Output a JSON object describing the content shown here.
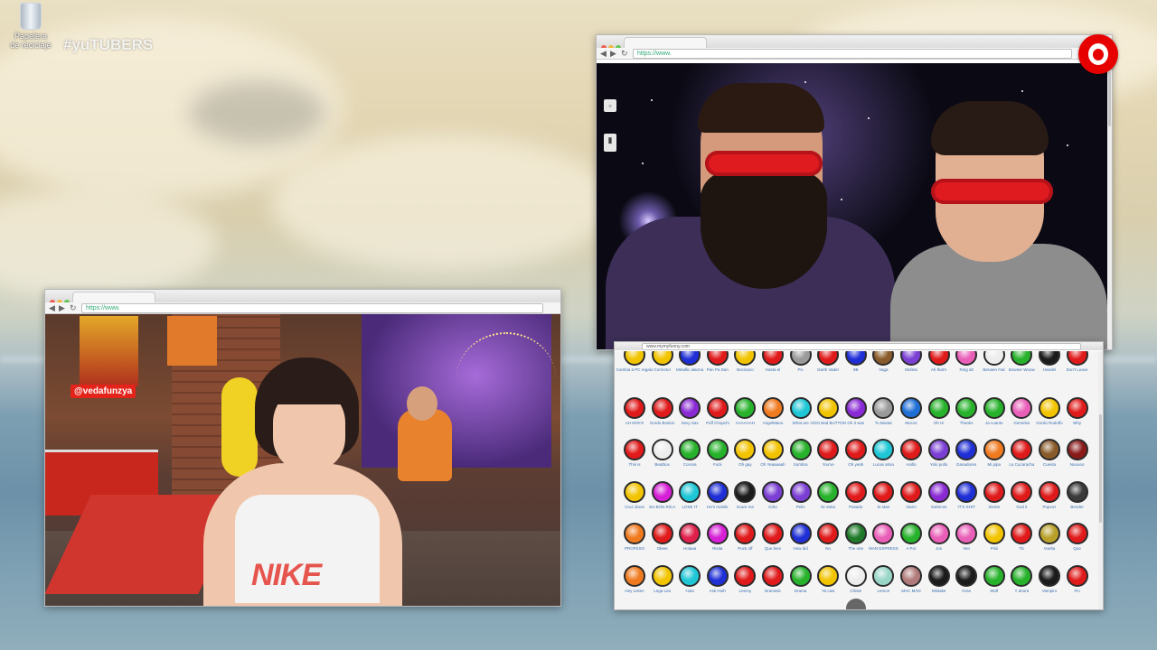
{
  "desktop": {
    "trash_label": "Papelera de reciclaje",
    "brand": "#yuTUBERS"
  },
  "windows": {
    "left": {
      "url": "https://www.",
      "hashtag": "@vedafunzya",
      "shirt_text": "NIKE"
    },
    "right_video": {
      "url": "https://www."
    },
    "soundboard": {
      "url": "www.mymyfunny.com"
    }
  },
  "colors": {
    "vodafone": "#e60000",
    "accent_green": "#3fa33a"
  },
  "soundboard": {
    "rows": [
      [
        {
          "c": "#f2c400",
          "l": "Cambia a PC regalo"
        },
        {
          "c": "#f2c400",
          "l": "Correcto!"
        },
        {
          "c": "#1f2fd6",
          "l": "Metallic alarma"
        },
        {
          "c": "#e01a1a",
          "l": "Pan Pa Dan"
        },
        {
          "c": "#f2c400",
          "l": "Bocinazo"
        },
        {
          "c": "#e01a1a",
          "l": "Hasta el"
        },
        {
          "c": "#9a9a9a",
          "l": "Pic"
        },
        {
          "c": "#e01a1a",
          "l": "Darth Vader"
        },
        {
          "c": "#1f2fd6",
          "l": "8B"
        },
        {
          "c": "#8a5b2a",
          "l": "Vaga"
        },
        {
          "c": "#7b3fd4",
          "l": "Mofeta"
        },
        {
          "c": "#e01a1a",
          "l": "Ah that's"
        },
        {
          "c": "#e95fb8",
          "l": "Ring alt"
        },
        {
          "c": "#ededed",
          "l": "Benaen Fair"
        },
        {
          "c": "#27b22b",
          "l": "Bowser Woow"
        },
        {
          "c": "#1b1b1b",
          "l": "Handel"
        },
        {
          "c": "#e01a1a",
          "l": "Don't Leave"
        }
      ],
      [
        {
          "c": "#e01a1a",
          "l": "AH NO!!!!!"
        },
        {
          "c": "#e01a1a",
          "l": "Gordo Boston"
        },
        {
          "c": "#8a2ad4",
          "l": "Sexy Sax"
        },
        {
          "c": "#e01a1a",
          "l": "Puff Chopchi"
        },
        {
          "c": "#27b22b",
          "l": "AAAAAAH"
        },
        {
          "c": "#f07a1f",
          "l": "AngelMano"
        },
        {
          "c": "#1fc7d6",
          "l": "What are"
        },
        {
          "c": "#f2c400",
          "l": "OOO Bad BUTTON"
        },
        {
          "c": "#8a2ad4",
          "l": "Oh it was"
        },
        {
          "c": "#9a9a9a",
          "l": "Tu Bastar"
        },
        {
          "c": "#1f6fd6",
          "l": "Mocos"
        },
        {
          "c": "#27b22b",
          "l": "Oh Hi"
        },
        {
          "c": "#27b22b",
          "l": "Thanks"
        },
        {
          "c": "#27b22b",
          "l": "Ja cuanto"
        },
        {
          "c": "#e95fb8",
          "l": "Gemidos"
        },
        {
          "c": "#f2c400",
          "l": "Gordo Rodolfo"
        },
        {
          "c": "#e01a1a",
          "l": "Why"
        }
      ],
      [
        {
          "c": "#e01a1a",
          "l": "This is"
        },
        {
          "c": "#ededed",
          "l": "Beatbox"
        },
        {
          "c": "#27b22b",
          "l": "Corona"
        },
        {
          "c": "#27b22b",
          "l": "Fuck"
        },
        {
          "c": "#f2c400",
          "l": "Oh gay"
        },
        {
          "c": "#f2c400",
          "l": "Oh Yeaaaaah"
        },
        {
          "c": "#27b22b",
          "l": "Sombra"
        },
        {
          "c": "#e01a1a",
          "l": "You've"
        },
        {
          "c": "#e01a1a",
          "l": "Oh yeah"
        },
        {
          "c": "#1fc7d6",
          "l": "Lucas alma"
        },
        {
          "c": "#e01a1a",
          "l": "Anillo"
        },
        {
          "c": "#7b3fd4",
          "l": "Yolo pollo"
        },
        {
          "c": "#1f2fd6",
          "l": "Ganadores"
        },
        {
          "c": "#f07a1f",
          "l": "Mi pipa"
        },
        {
          "c": "#e01a1a",
          "l": "La Cucaracha"
        },
        {
          "c": "#8a5b2a",
          "l": "Cuesta"
        },
        {
          "c": "#8a1a1a",
          "l": "Nooooo"
        }
      ],
      [
        {
          "c": "#f2c400",
          "l": "Cruz dioos"
        },
        {
          "c": "#d61fd6",
          "l": "SU BON RICA"
        },
        {
          "c": "#1fc7d6",
          "l": "LOSE IT"
        },
        {
          "c": "#1f2fd6",
          "l": "He's mobile"
        },
        {
          "c": "#1b1b1b",
          "l": "Scare me"
        },
        {
          "c": "#7b3fd4",
          "l": "Grito"
        },
        {
          "c": "#7b3fd4",
          "l": "Pelis"
        },
        {
          "c": "#27b22b",
          "l": "Ni visita"
        },
        {
          "c": "#e01a1a",
          "l": "Pasado"
        },
        {
          "c": "#e01a1a",
          "l": "Si stan"
        },
        {
          "c": "#e01a1a",
          "l": "Alarm"
        },
        {
          "c": "#8a2ad4",
          "l": "Subimos"
        },
        {
          "c": "#1f2fd6",
          "l": "IT'S SHIT"
        },
        {
          "c": "#e01a1a",
          "l": "Siente"
        },
        {
          "c": "#e01a1a",
          "l": "God it"
        },
        {
          "c": "#e01a1a",
          "l": "Pupvoz"
        },
        {
          "c": "#3a3a3a",
          "l": "Bender"
        }
      ],
      [
        {
          "c": "#f07a1f",
          "l": "PROFESO"
        },
        {
          "c": "#e01a1a",
          "l": "Oleee"
        },
        {
          "c": "#e0204a",
          "l": "Holaaa"
        },
        {
          "c": "#d61fd6",
          "l": "Risita"
        },
        {
          "c": "#e01a1a",
          "l": "Puck off"
        },
        {
          "c": "#e01a1a",
          "l": "Que bien"
        },
        {
          "c": "#1f2fd6",
          "l": "How did"
        },
        {
          "c": "#e01a1a",
          "l": "No"
        },
        {
          "c": "#1e7a2a",
          "l": "The one"
        },
        {
          "c": "#e95fb8",
          "l": "MAN ESPRESS"
        },
        {
          "c": "#27b22b",
          "l": "A Por"
        },
        {
          "c": "#e95fb8",
          "l": "Jos"
        },
        {
          "c": "#e95fb8",
          "l": "Ven"
        },
        {
          "c": "#f2c400",
          "l": "Piiiii"
        },
        {
          "c": "#e01a1a",
          "l": "Tic"
        },
        {
          "c": "#b8a02a",
          "l": "Vuelta"
        },
        {
          "c": "#e01a1a",
          "l": "Que"
        }
      ],
      [
        {
          "c": "#f07a1f",
          "l": "Hey Listen"
        },
        {
          "c": "#f2c400",
          "l": "Lega Lea"
        },
        {
          "c": "#1fc7d6",
          "l": "Hola"
        },
        {
          "c": "#1f2fd6",
          "l": "Ask Hoth"
        },
        {
          "c": "#e01a1a",
          "l": "Leeroy"
        },
        {
          "c": "#e01a1a",
          "l": "Dramatic"
        },
        {
          "c": "#27b22b",
          "l": "Drama"
        },
        {
          "c": "#f2c400",
          "l": "Ya casi"
        },
        {
          "c": "#ededed",
          "l": "Chiste"
        },
        {
          "c": "#9ad6c8",
          "l": "Lemon"
        },
        {
          "c": "#b07a7a",
          "l": "MAC MAN"
        },
        {
          "c": "#1b1b1b",
          "l": "Mistake"
        },
        {
          "c": "#1b1b1b",
          "l": "Gran"
        },
        {
          "c": "#27b22b",
          "l": "Wolf"
        },
        {
          "c": "#27b22b",
          "l": "Y ahora"
        },
        {
          "c": "#1b1b1b",
          "l": "Vampiro"
        },
        {
          "c": "#e01a1a",
          "l": "Fin"
        }
      ]
    ]
  }
}
